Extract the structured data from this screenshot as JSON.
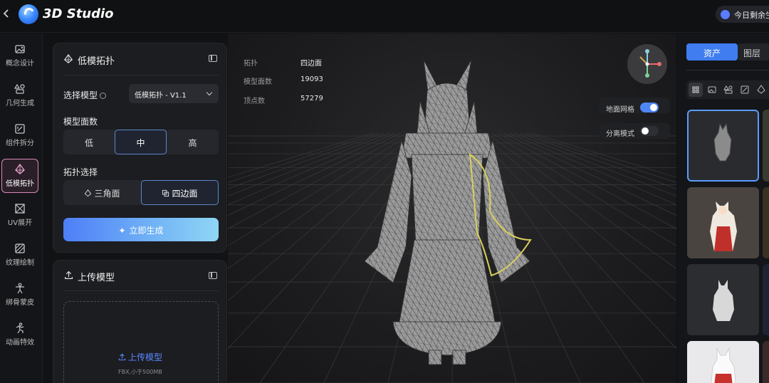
{
  "app": {
    "title": "3D Studio",
    "quota_label": "今日剩余生"
  },
  "rail": {
    "items": [
      {
        "label": "概念设计",
        "icon": "image-plus-icon"
      },
      {
        "label": "几何生成",
        "icon": "shapes-icon"
      },
      {
        "label": "组件拆分",
        "icon": "split-box-icon"
      },
      {
        "label": "低模拓扑",
        "icon": "lowpoly-icon",
        "active": true
      },
      {
        "label": "UV展开",
        "icon": "uv-unwrap-icon"
      },
      {
        "label": "纹理绘制",
        "icon": "texture-brush-icon"
      },
      {
        "label": "绑骨蒙皮",
        "icon": "rig-figure-icon"
      },
      {
        "label": "动画特效",
        "icon": "running-figure-icon"
      }
    ]
  },
  "topology_panel": {
    "title": "低模拓扑",
    "model_label": "选择模型",
    "model_value": "低模拓扑 - V1.1",
    "faces_label": "模型面数",
    "faces_options": [
      "低",
      "中",
      "高"
    ],
    "faces_selected": "中",
    "topology_label": "拓扑选择",
    "topology_options": [
      "三角面",
      "四边面"
    ],
    "topology_selected": "四边面",
    "generate_label": "立即生成"
  },
  "upload_panel": {
    "title": "上传模型",
    "link_label": "上传模型",
    "hint": "FBX,小于500MB"
  },
  "viewport": {
    "stats": [
      {
        "key": "拓扑",
        "value": "四边面"
      },
      {
        "key": "模型面数",
        "value": "19093"
      },
      {
        "key": "顶点数",
        "value": "57279"
      }
    ],
    "toggles": [
      {
        "label": "地面网格",
        "on": true
      },
      {
        "label": "分离模式",
        "on": false
      }
    ]
  },
  "assets": {
    "tabs": [
      "资产",
      "图层"
    ],
    "active_tab": "资产",
    "filters": [
      "grid-icon",
      "image-icon",
      "shapes-icon",
      "box-icon",
      "lowpoly-icon"
    ],
    "selected_thumb_index": 0
  },
  "colors": {
    "accent": "#3f7df0",
    "active_rail_border": "#d889b8",
    "toggle_on": "#4f86f5"
  }
}
